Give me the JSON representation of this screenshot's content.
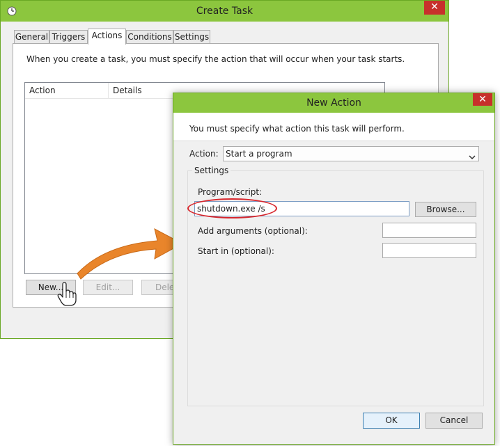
{
  "create_task": {
    "title": "Create Task",
    "close": "✕",
    "tabs": [
      "General",
      "Triggers",
      "Actions",
      "Conditions",
      "Settings"
    ],
    "description": "When you create a task, you must specify the action that will occur when your task starts.",
    "columns": [
      "Action",
      "Details"
    ],
    "buttons": {
      "new": "New...",
      "edit": "Edit...",
      "delete": "Delet"
    }
  },
  "new_action": {
    "title": "New Action",
    "close": "✕",
    "description": "You must specify what action this task will perform.",
    "action_label": "Action:",
    "action_value": "Start a program",
    "settings_label": "Settings",
    "program_label": "Program/script:",
    "program_value": "shutdown.exe /s",
    "browse": "Browse...",
    "arguments_label": "Add arguments (optional):",
    "arguments_value": "",
    "start_in_label": "Start in (optional):",
    "start_in_value": "",
    "ok": "OK",
    "cancel": "Cancel"
  },
  "colors": {
    "frame": "#8cc63e",
    "close": "#c7302b",
    "highlight": "#d8282e",
    "arrow": "#e9852b"
  },
  "icons": [
    "clock-icon",
    "close-icon",
    "chevron-down-icon",
    "hand-cursor-icon",
    "arrow-annotation"
  ]
}
